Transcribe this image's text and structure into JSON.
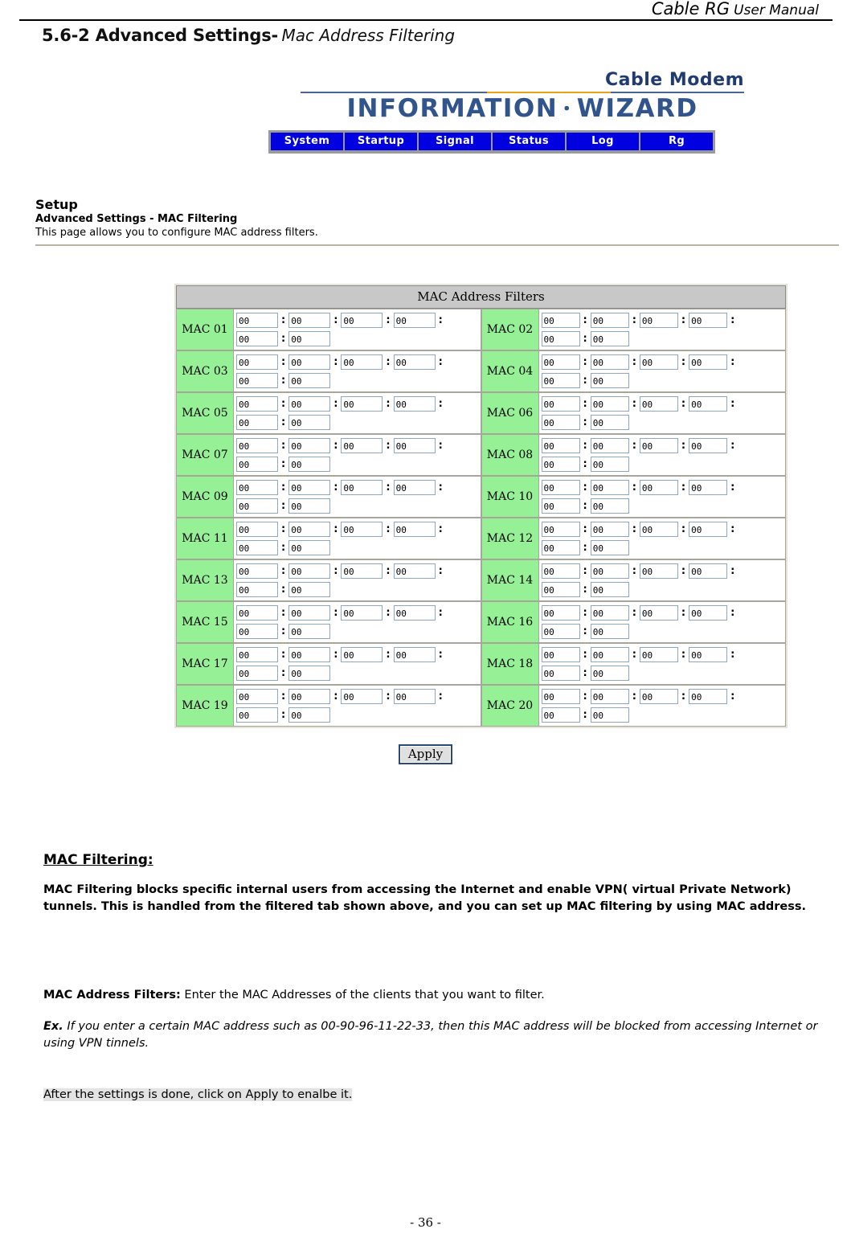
{
  "header": {
    "manual_title_main": "Cable RG",
    "manual_title_sub": "User Manual"
  },
  "section": {
    "number_and_title": "5.6-2 Advanced Settings-",
    "subtitle": "Mac Address Filtering"
  },
  "logo": {
    "product": "Cable Modem",
    "banner_left": "INFORMATION",
    "banner_sep": "・",
    "banner_right": "WIZARD",
    "rule_color": "#4a6594",
    "rule_accent_color": "#e8a017",
    "text_color": "#31548c"
  },
  "nav": {
    "background": "#0000e0",
    "text_color": "#ffffff",
    "tabs": [
      {
        "label": "System"
      },
      {
        "label": "Startup"
      },
      {
        "label": "Signal"
      },
      {
        "label": "Status"
      },
      {
        "label": "Log"
      },
      {
        "label": "Rg"
      }
    ]
  },
  "setup": {
    "title": "Setup",
    "subtitle": "Advanced Settings - MAC Filtering",
    "description": "This page allows you to configure MAC address filters."
  },
  "mac_table": {
    "caption": "MAC Address Filters",
    "header_background": "#c8c8c8",
    "label_background": "#96f096",
    "octet_value": "00",
    "separator": ":",
    "rows": [
      {
        "left": {
          "label": "MAC 01",
          "octets": [
            "00",
            "00",
            "00",
            "00",
            "00",
            "00"
          ]
        },
        "right": {
          "label": "MAC 02",
          "octets": [
            "00",
            "00",
            "00",
            "00",
            "00",
            "00"
          ]
        }
      },
      {
        "left": {
          "label": "MAC 03",
          "octets": [
            "00",
            "00",
            "00",
            "00",
            "00",
            "00"
          ]
        },
        "right": {
          "label": "MAC 04",
          "octets": [
            "00",
            "00",
            "00",
            "00",
            "00",
            "00"
          ]
        }
      },
      {
        "left": {
          "label": "MAC 05",
          "octets": [
            "00",
            "00",
            "00",
            "00",
            "00",
            "00"
          ]
        },
        "right": {
          "label": "MAC 06",
          "octets": [
            "00",
            "00",
            "00",
            "00",
            "00",
            "00"
          ]
        }
      },
      {
        "left": {
          "label": "MAC 07",
          "octets": [
            "00",
            "00",
            "00",
            "00",
            "00",
            "00"
          ]
        },
        "right": {
          "label": "MAC 08",
          "octets": [
            "00",
            "00",
            "00",
            "00",
            "00",
            "00"
          ]
        }
      },
      {
        "left": {
          "label": "MAC 09",
          "octets": [
            "00",
            "00",
            "00",
            "00",
            "00",
            "00"
          ]
        },
        "right": {
          "label": "MAC 10",
          "octets": [
            "00",
            "00",
            "00",
            "00",
            "00",
            "00"
          ]
        }
      },
      {
        "left": {
          "label": "MAC 11",
          "octets": [
            "00",
            "00",
            "00",
            "00",
            "00",
            "00"
          ]
        },
        "right": {
          "label": "MAC 12",
          "octets": [
            "00",
            "00",
            "00",
            "00",
            "00",
            "00"
          ]
        }
      },
      {
        "left": {
          "label": "MAC 13",
          "octets": [
            "00",
            "00",
            "00",
            "00",
            "00",
            "00"
          ]
        },
        "right": {
          "label": "MAC 14",
          "octets": [
            "00",
            "00",
            "00",
            "00",
            "00",
            "00"
          ]
        }
      },
      {
        "left": {
          "label": "MAC 15",
          "octets": [
            "00",
            "00",
            "00",
            "00",
            "00",
            "00"
          ]
        },
        "right": {
          "label": "MAC 16",
          "octets": [
            "00",
            "00",
            "00",
            "00",
            "00",
            "00"
          ]
        }
      },
      {
        "left": {
          "label": "MAC 17",
          "octets": [
            "00",
            "00",
            "00",
            "00",
            "00",
            "00"
          ]
        },
        "right": {
          "label": "MAC 18",
          "octets": [
            "00",
            "00",
            "00",
            "00",
            "00",
            "00"
          ]
        }
      },
      {
        "left": {
          "label": "MAC 19",
          "octets": [
            "00",
            "00",
            "00",
            "00",
            "00",
            "00"
          ]
        },
        "right": {
          "label": "MAC 20",
          "octets": [
            "00",
            "00",
            "00",
            "00",
            "00",
            "00"
          ]
        }
      }
    ]
  },
  "apply": {
    "label": "Apply"
  },
  "notes": {
    "heading": "MAC Filtering:",
    "paragraph": "MAC Filtering blocks specific internal users from accessing the Internet and enable VPN( virtual Private Network) tunnels. This is handled from the filtered tab shown above, and you can set up MAC filtering by using MAC address.",
    "filters_label": "MAC Address Filters:",
    "filters_text": " Enter the MAC Addresses of the clients that you want to filter.",
    "example_label": "Ex.",
    "example_text": " If you enter a certain MAC address such as 00-90-96-11-22-33, then this MAC address will be blocked from accessing Internet or using VPN tinnels.",
    "after_settings": "After the settings is done, click on Apply to enalbe it.",
    "highlight_color": "#e3e3e3"
  },
  "footer": {
    "page_number": "- 36 -"
  }
}
